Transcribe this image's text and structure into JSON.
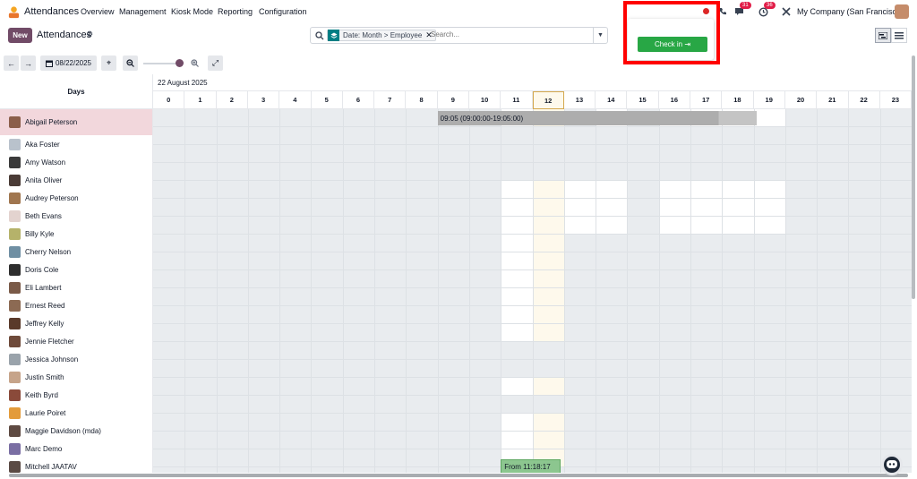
{
  "nav": {
    "app_name": "Attendances",
    "menus": [
      "Overview",
      "Management",
      "Kiosk Mode",
      "Reporting",
      "Configuration"
    ],
    "messages_badge": "31",
    "activities_badge": "36",
    "company": "My Company (San Francisco)"
  },
  "control": {
    "new_label": "New",
    "title": "Attendances",
    "facet_label": "Date: Month > Employee",
    "search_placeholder": "Search...",
    "date_button": "08/22/2025"
  },
  "popup": {
    "checkin_label": "Check in ⇥"
  },
  "gantt": {
    "days_label": "Days",
    "date_label": "22 August 2025",
    "hours": [
      "0",
      "1",
      "2",
      "3",
      "4",
      "5",
      "6",
      "7",
      "8",
      "9",
      "10",
      "11",
      "12",
      "13",
      "14",
      "15",
      "16",
      "17",
      "18",
      "19",
      "20",
      "21",
      "22",
      "23"
    ],
    "today_hour": "12",
    "employees": [
      "Abigail Peterson",
      "Aka Foster",
      "Amy Watson",
      "Anita Oliver",
      "Audrey Peterson",
      "Beth Evans",
      "Billy Kyle",
      "Cherry Nelson",
      "Doris Cole",
      "Eli Lambert",
      "Ernest Reed",
      "Jeffrey Kelly",
      "Jennie Fletcher",
      "Jessica Johnson",
      "Justin Smith",
      "Keith Byrd",
      "Laurie Poiret",
      "Maggie Davidson (mda)",
      "Marc Demo",
      "Mitchell JAATAV"
    ],
    "selected_employee": "Abigail Peterson",
    "pills": [
      {
        "label": "09:05 (09:00:00-19:05:00)",
        "employee": "Abigail Peterson",
        "start_hour": 9.0,
        "end_hour": 19.1
      },
      {
        "label": "From 11:18:17",
        "employee": "Mitchell JAATAV",
        "start_hour": 11.0,
        "end_hour": 12.9
      }
    ]
  },
  "colors": {
    "brand": "#714b67",
    "checkin": "#28a745",
    "selected_row": "#f2d7dc",
    "today": "#fef9ec"
  }
}
